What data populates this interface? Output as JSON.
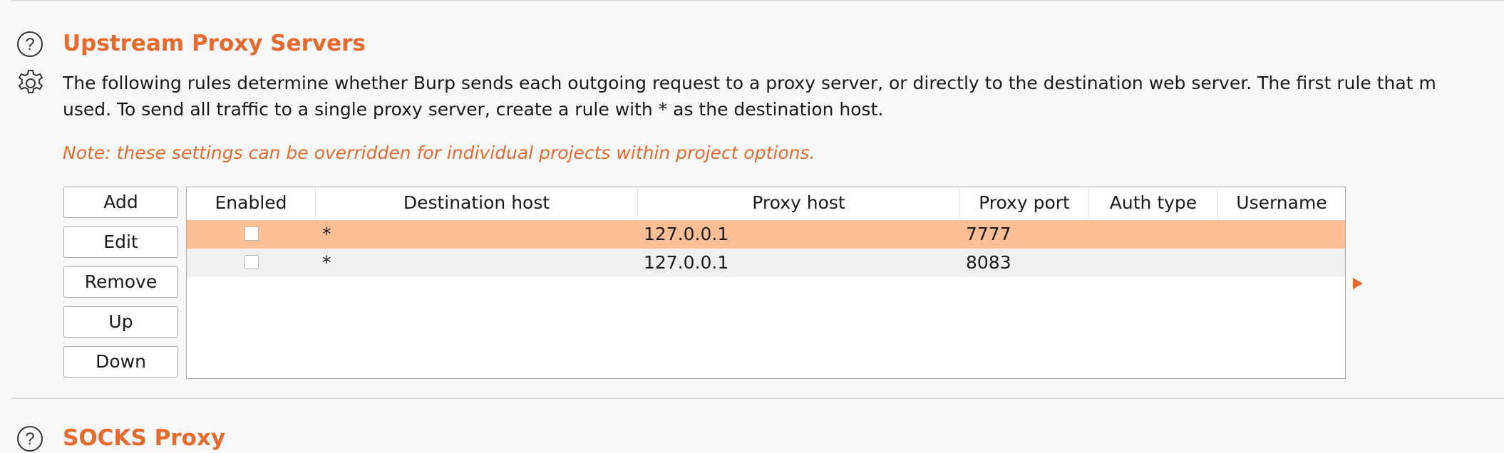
{
  "upstream": {
    "title": "Upstream Proxy Servers",
    "description_line1": "The following rules determine whether Burp sends each outgoing request to a proxy server, or directly to the destination web server. The first rule that m",
    "description_line2": "used. To send all traffic to a single proxy server, create a rule with * as the destination host.",
    "note": "Note: these settings can be overridden for individual projects within project options.",
    "buttons": {
      "add": "Add",
      "edit": "Edit",
      "remove": "Remove",
      "up": "Up",
      "down": "Down"
    },
    "table": {
      "columns": [
        "Enabled",
        "Destination host",
        "Proxy host",
        "Proxy port",
        "Auth type",
        "Username"
      ],
      "rows": [
        {
          "enabled": false,
          "destination_host": "*",
          "proxy_host": "127.0.0.1",
          "proxy_port": "7777",
          "auth_type": "",
          "username": "",
          "selected": true
        },
        {
          "enabled": false,
          "destination_host": "*",
          "proxy_host": "127.0.0.1",
          "proxy_port": "8083",
          "auth_type": "",
          "username": "",
          "selected": false
        }
      ]
    }
  },
  "socks": {
    "title": "SOCKS Proxy"
  },
  "colors": {
    "accent": "#e8692c",
    "selected_row": "#fbbe95",
    "alt_row": "#efefef"
  },
  "icons": {
    "help": "help-circle-icon",
    "settings": "gear-icon",
    "expand": "triangle-right-icon"
  }
}
